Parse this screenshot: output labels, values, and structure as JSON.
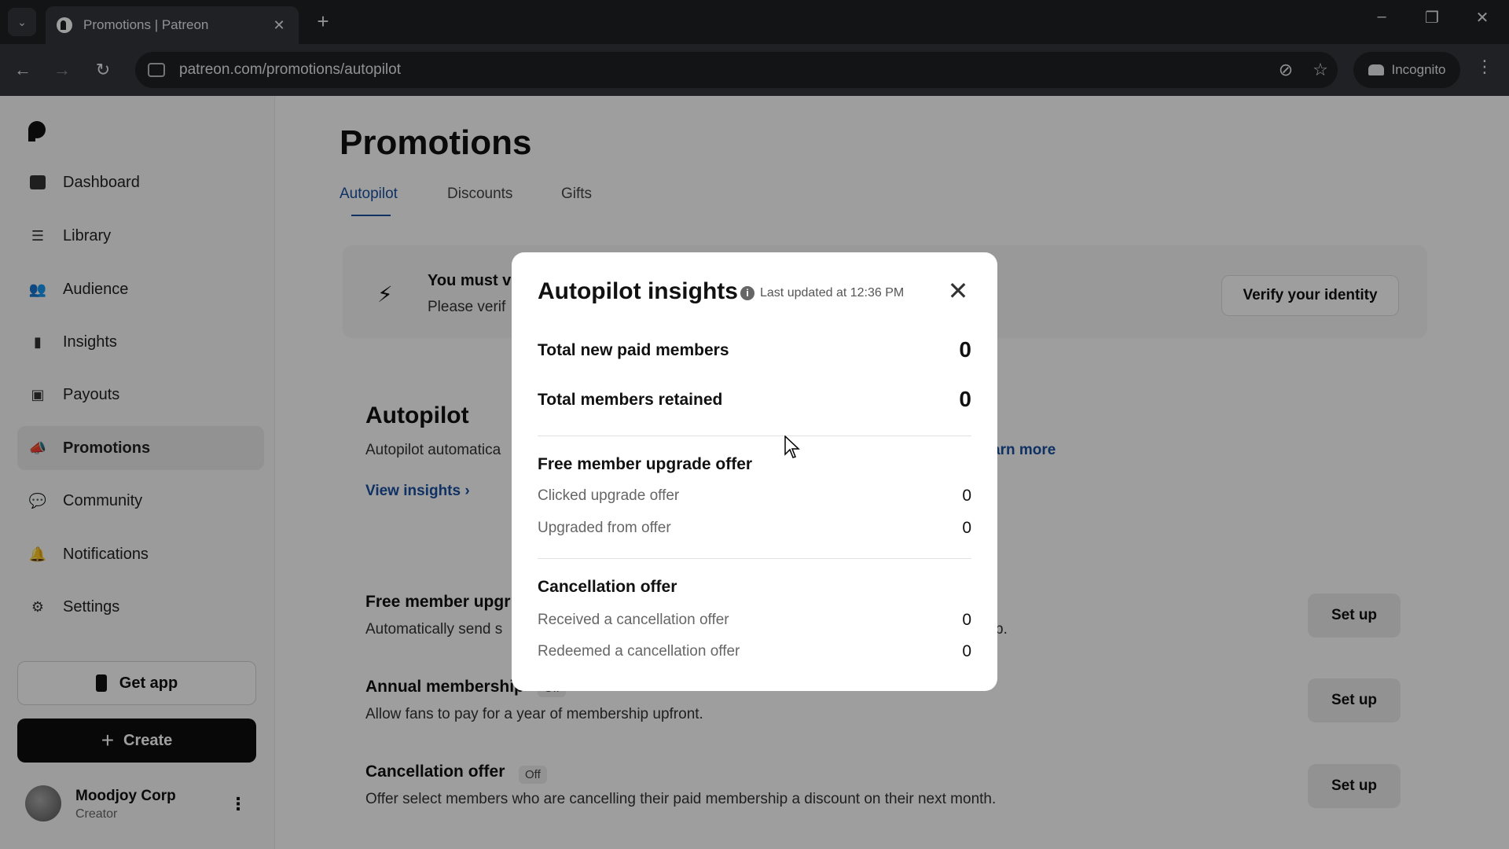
{
  "browser": {
    "tab_title": "Promotions | Patreon",
    "url": "patreon.com/promotions/autopilot",
    "incognito_label": "Incognito"
  },
  "sidebar": {
    "items": [
      {
        "label": "Dashboard",
        "icon": "dashboard-icon"
      },
      {
        "label": "Library",
        "icon": "library-icon"
      },
      {
        "label": "Audience",
        "icon": "audience-icon"
      },
      {
        "label": "Insights",
        "icon": "insights-icon"
      },
      {
        "label": "Payouts",
        "icon": "payouts-icon"
      },
      {
        "label": "Promotions",
        "icon": "megaphone-icon",
        "active": true
      },
      {
        "label": "Community",
        "icon": "community-icon"
      },
      {
        "label": "Notifications",
        "icon": "bell-icon"
      },
      {
        "label": "Settings",
        "icon": "gear-icon"
      }
    ],
    "get_app_label": "Get app",
    "create_label": "Create",
    "user": {
      "name": "Moodjoy Corp",
      "role": "Creator"
    }
  },
  "main": {
    "title": "Promotions",
    "tabs": [
      "Autopilot",
      "Discounts",
      "Gifts"
    ],
    "banner": {
      "title": "You must v",
      "subtitle": "Please verif",
      "button": "Verify your identity"
    },
    "autopilot": {
      "title": "Autopilot",
      "description": "Autopilot automatica",
      "learn_more": "arn more",
      "view_insights": "View insights"
    },
    "rows": [
      {
        "title": "Free member upgr",
        "description": "Automatically send s",
        "description_tail": "p.",
        "button": "Set up"
      },
      {
        "title": "Annual membership",
        "badge": "Off",
        "description": "Allow fans to pay for a year of membership upfront.",
        "button": "Set up"
      },
      {
        "title": "Cancellation offer",
        "badge": "Off",
        "description": "Offer select members who are cancelling their paid membership a discount on their next month.",
        "button": "Set up"
      }
    ]
  },
  "modal": {
    "title": "Autopilot insights",
    "last_updated": "Last updated at 12:36 PM",
    "totals": [
      {
        "label": "Total new paid members",
        "value": "0"
      },
      {
        "label": "Total members retained",
        "value": "0"
      }
    ],
    "upgrade_section": {
      "title": "Free member upgrade offer",
      "rows": [
        {
          "label": "Clicked upgrade offer",
          "value": "0"
        },
        {
          "label": "Upgraded from offer",
          "value": "0"
        }
      ]
    },
    "cancellation_section": {
      "title": "Cancellation offer",
      "rows": [
        {
          "label": "Received a cancellation offer",
          "value": "0"
        },
        {
          "label": "Redeemed a cancellation offer",
          "value": "0"
        }
      ]
    }
  }
}
